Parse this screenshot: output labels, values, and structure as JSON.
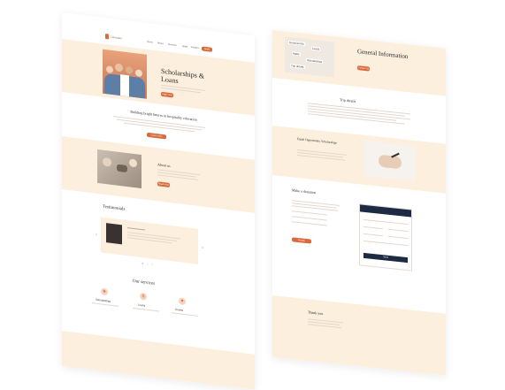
{
  "left_page": {
    "logo_text": "Tidewater",
    "nav": [
      "Home",
      "About",
      "Services",
      "Apply",
      "Contact"
    ],
    "nav_button": "Apply",
    "hero": {
      "title": "Scholarships & Loans",
      "button": "Apply now"
    },
    "mission": {
      "title": "Building bright futures in hospitality education",
      "button": "Learn more"
    },
    "about": {
      "title": "About us",
      "button": "Read more"
    },
    "testimonials": {
      "title": "Testimonials",
      "prev": "‹",
      "next": "›"
    },
    "services": {
      "title": "Our services",
      "items": [
        "Scholarships",
        "Loans",
        "Grants"
      ]
    }
  },
  "right_page": {
    "note_words": [
      "General Info",
      "Loans",
      "Apply",
      "Scholarships",
      "Trip details"
    ],
    "hero": {
      "title": "General Information",
      "button": "Contact us"
    },
    "trip": {
      "title": "Trip details"
    },
    "equal": {
      "title": "Equal Opportunity Scholarships"
    },
    "donation": {
      "title": "Make a donation",
      "button": "Donate"
    },
    "form": {
      "submit": "Send"
    },
    "thanks": {
      "title": "Thank you"
    }
  },
  "colors": {
    "accent": "#d86a3c",
    "cream": "#fcefdd",
    "navy": "#1c2a44"
  }
}
